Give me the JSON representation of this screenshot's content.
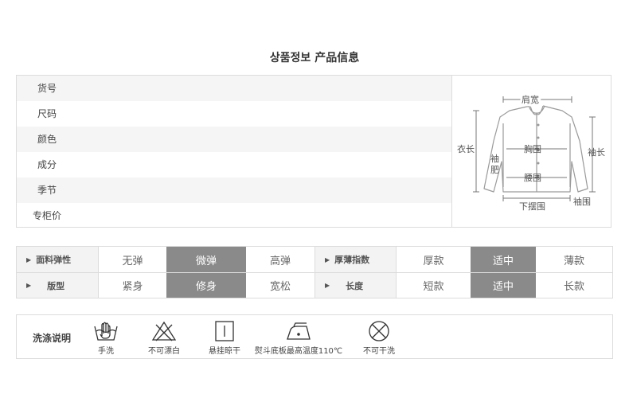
{
  "title": "상품정보 产品信息",
  "info": {
    "rows": [
      {
        "label": "货号"
      },
      {
        "label": "尺码"
      },
      {
        "label": "颜色"
      },
      {
        "label": "成分"
      },
      {
        "label": "季节"
      },
      {
        "label": "专柜价"
      }
    ],
    "diagram": {
      "shoulder": "肩宽",
      "length": "衣长",
      "sleeve_fat1": "袖",
      "sleeve_fat2": "肥",
      "chest": "胸围",
      "waist": "腰围",
      "sleeve_len": "袖长",
      "hem": "下摆围",
      "cuff": "袖围"
    }
  },
  "attributes": {
    "row1": {
      "head_a": "面料弹性",
      "opts_a": [
        "无弹",
        "微弹",
        "高弹"
      ],
      "selected_a": "微弹",
      "head_b": "厚薄指数",
      "opts_b": [
        "厚款",
        "适中",
        "薄款"
      ],
      "selected_b": "适中"
    },
    "row2": {
      "head_a": "版型",
      "opts_a": [
        "紧身",
        "修身",
        "宽松"
      ],
      "selected_a": "修身",
      "head_b": "长度",
      "opts_b": [
        "短款",
        "适中",
        "长款"
      ],
      "selected_b": "适中"
    },
    "selected_color": "#8a8a8a"
  },
  "wash": {
    "label": "洗涤说明",
    "items": [
      {
        "icon": "hand-wash-icon",
        "caption": "手洗"
      },
      {
        "icon": "no-bleach-icon",
        "caption": "不可漂白"
      },
      {
        "icon": "hang-dry-icon",
        "caption": "悬挂晾干"
      },
      {
        "icon": "iron-icon",
        "caption": "熨斗底板最高温度110℃"
      },
      {
        "icon": "no-dry-clean-icon",
        "caption": "不可干洗"
      }
    ]
  }
}
